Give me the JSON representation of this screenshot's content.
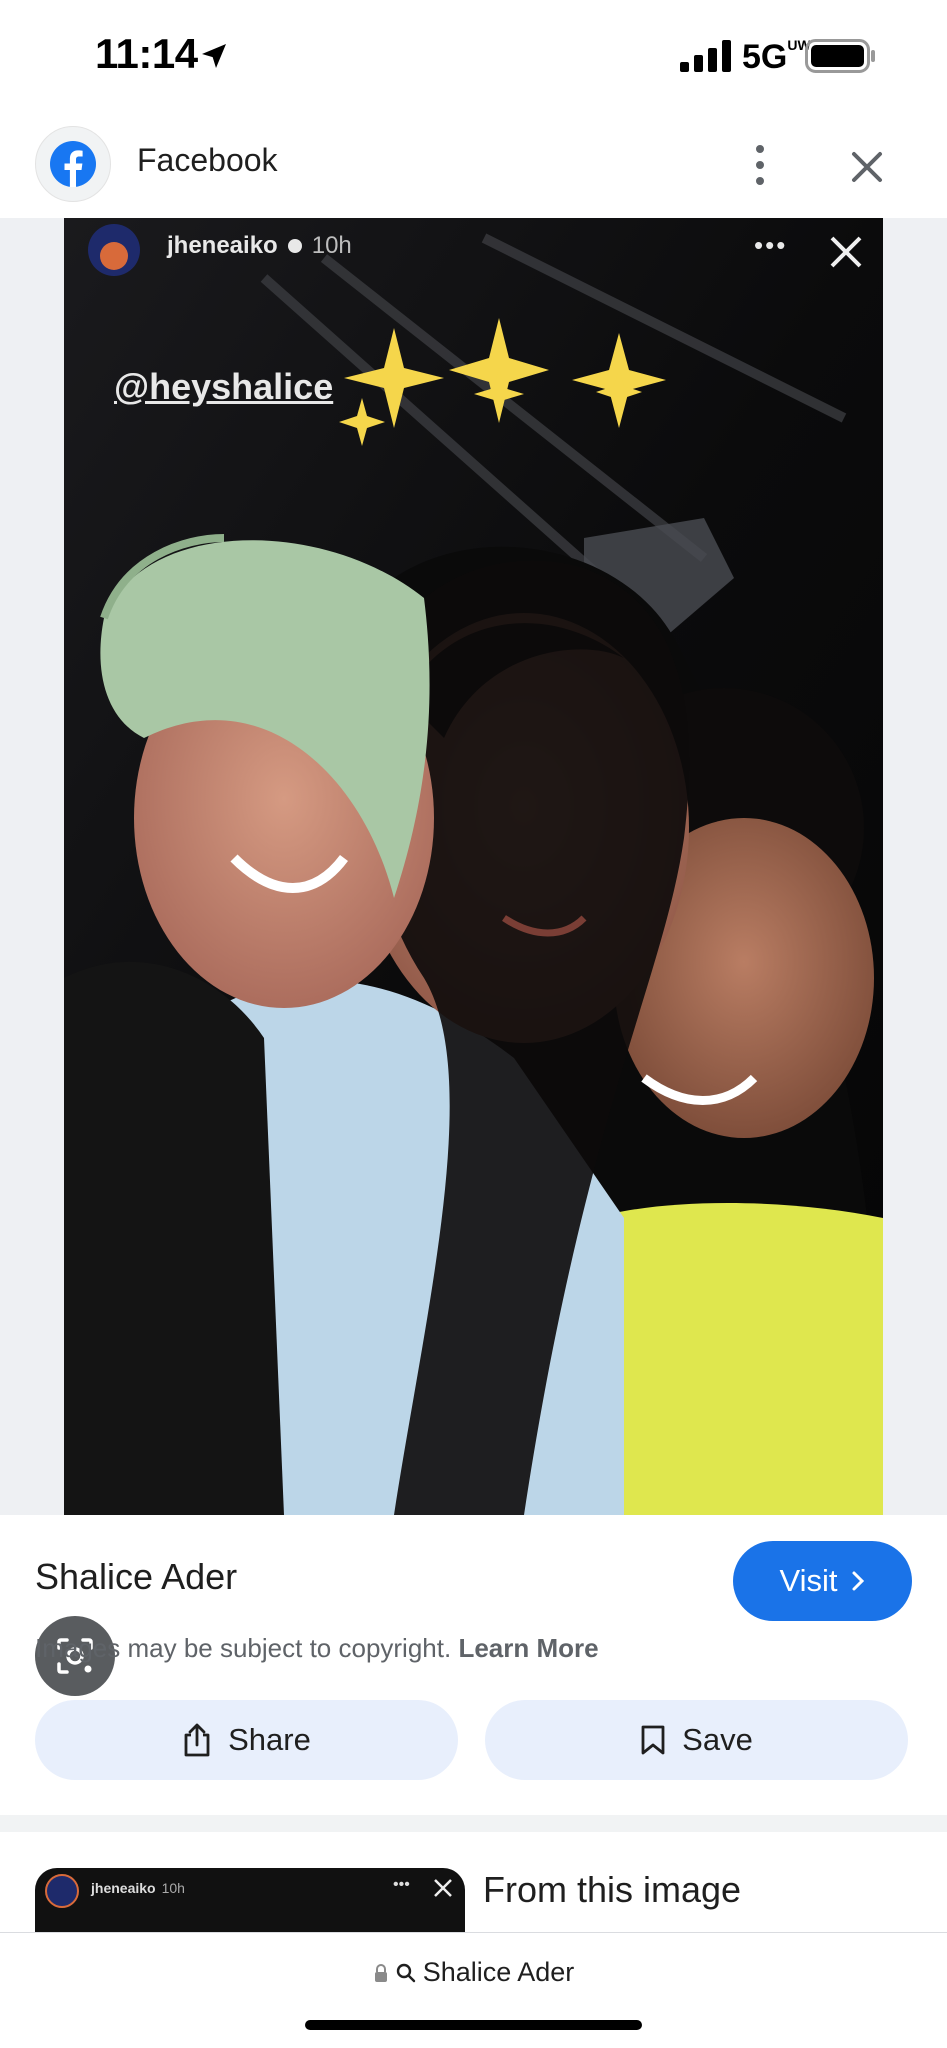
{
  "status_bar": {
    "time": "11:14",
    "network": "5G",
    "network_suffix": "UW",
    "icons": [
      "location-arrow-icon",
      "signal-bars-icon",
      "battery-icon"
    ]
  },
  "header": {
    "app_icon": "facebook-logo-icon",
    "title": "Facebook",
    "more_icon": "more-vert-icon",
    "close_icon": "close-icon"
  },
  "image": {
    "story_username": "jheneaiko",
    "story_time": "10h",
    "mention": "@heyshalice",
    "lens_icon": "lens-search-icon"
  },
  "result": {
    "source_name": "Shalice Ader",
    "visit_label": "Visit",
    "copyright_text": "Images may be subject to copyright.",
    "learn_more": "Learn More",
    "share_label": "Share",
    "save_label": "Save"
  },
  "related": {
    "thumb_username": "jheneaiko",
    "thumb_time": "10h",
    "heading": "From this image"
  },
  "url_bar": {
    "query": "Shalice Ader"
  },
  "colors": {
    "accent": "#1a73e8",
    "facebook_blue": "#1877f2",
    "button_bg": "#e8effc"
  }
}
